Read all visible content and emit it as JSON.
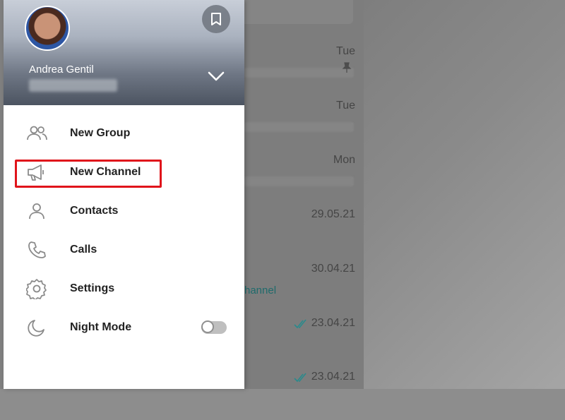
{
  "user": {
    "name": "Andrea Gentil"
  },
  "menu": {
    "items": [
      {
        "label": "New Group",
        "icon": "group-icon"
      },
      {
        "label": "New Channel",
        "icon": "megaphone-icon"
      },
      {
        "label": "Contacts",
        "icon": "person-icon"
      },
      {
        "label": "Calls",
        "icon": "phone-icon"
      },
      {
        "label": "Settings",
        "icon": "gear-icon"
      },
      {
        "label": "Night Mode",
        "icon": "moon-icon"
      }
    ],
    "night_mode_on": false
  },
  "chats": [
    {
      "time": "Tue"
    },
    {
      "time": "Tue"
    },
    {
      "time": "Mon"
    },
    {
      "time": "29.05.21"
    },
    {
      "time": "30.04.21",
      "preview": "hannel"
    },
    {
      "time": "23.04.21"
    },
    {
      "time": "23.04.21"
    }
  ],
  "colors": {
    "highlight": "#e0141b",
    "accent": "#1f6b6c"
  }
}
